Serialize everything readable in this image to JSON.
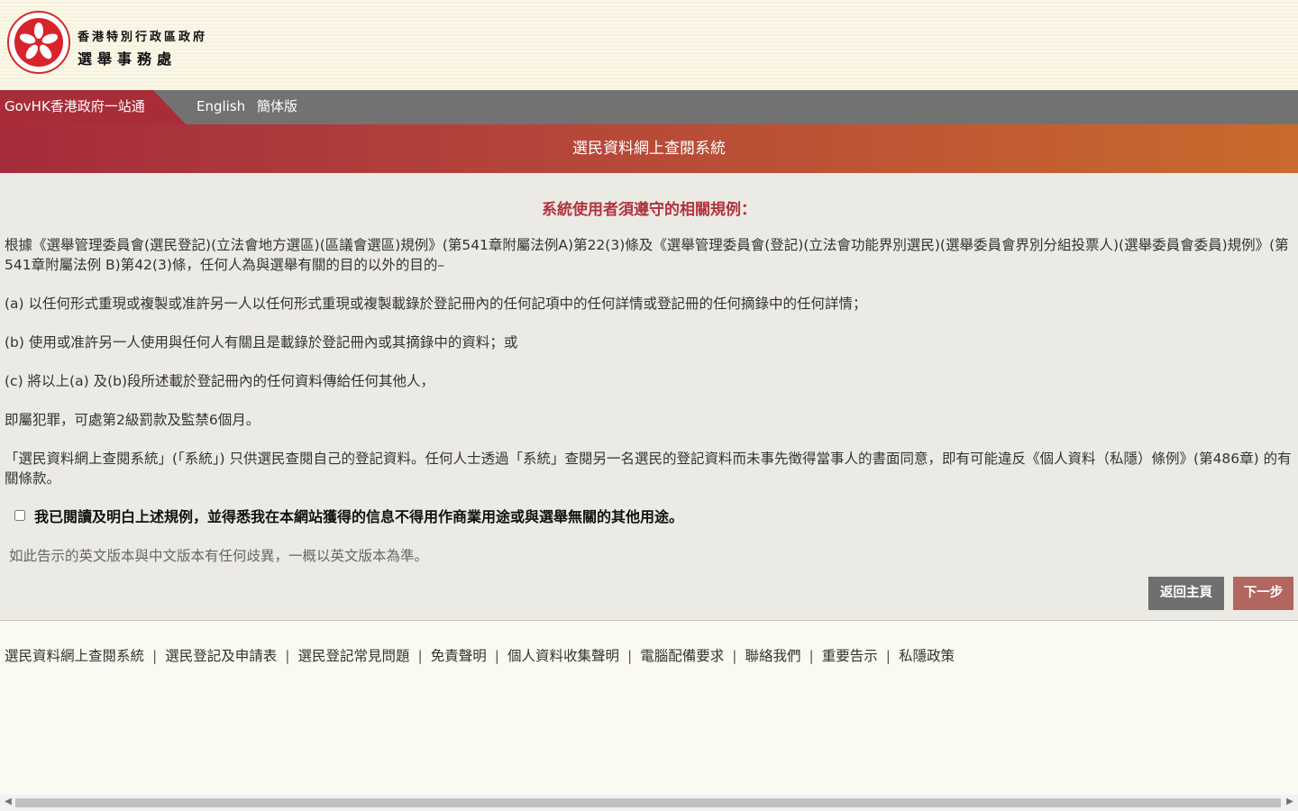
{
  "header": {
    "dept_line1": "香港特別行政區政府",
    "dept_line2": "選舉事務處"
  },
  "topbar": {
    "govhk": "GovHK香港政府一站通",
    "lang_en": "English",
    "lang_sc": "簡体版"
  },
  "banner": {
    "title": "選民資料網上查閱系統"
  },
  "content": {
    "rules_title": "系統使用者須遵守的相關規例：",
    "intro": "根據《選舉管理委員會(選民登記)(立法會地方選區)(區議會選區)規例》(第541章附屬法例A)第22(3)條及《選舉管理委員會(登記)(立法會功能界別選民)(選舉委員會界別分組投票人)(選舉委員會委員)規例》(第541章附屬法例 B)第42(3)條，任何人為與選舉有關的目的以外的目的–",
    "item_a": "(a) 以任何形式重現或複製或准許另一人以任何形式重現或複製載錄於登記冊內的任何記項中的任何詳情或登記冊的任何摘錄中的任何詳情；",
    "item_b": "(b) 使用或准許另一人使用與任何人有關且是載錄於登記冊內或其摘錄中的資料；或",
    "item_c": "(c) 將以上(a) 及(b)段所述載於登記冊內的任何資料傳給任何其他人，",
    "penalty": "即屬犯罪，可處第2級罰款及監禁6個月。",
    "notice": "「選民資料網上查閱系統」(「系統」) 只供選民查閱自己的登記資料。任何人士透過「系統」查閱另一名選民的登記資料而未事先徵得當事人的書面同意，即有可能違反《個人資料（私隱）條例》(第486章) 的有關條款。",
    "agree": "我已閱讀及明白上述規例，並得悉我在本網站獲得的信息不得用作商業用途或與選舉無關的其他用途。",
    "lang_note": "如此告示的英文版本與中文版本有任何歧異，一概以英文版本為準。",
    "btn_home": "返回主頁",
    "btn_next": "下一步"
  },
  "footer": {
    "links": [
      "選民資料網上查閱系統",
      "選民登記及申請表",
      "選民登記常見問題",
      "免責聲明",
      "個人資料收集聲明",
      "電腦配備要求",
      "聯絡我們",
      "重要告示",
      "私隱政策"
    ]
  },
  "colors": {
    "accent_red": "#a82d39",
    "banner_end": "#cb6a2d",
    "topbar_gray": "#727272",
    "btn_next": "#b1665f"
  }
}
